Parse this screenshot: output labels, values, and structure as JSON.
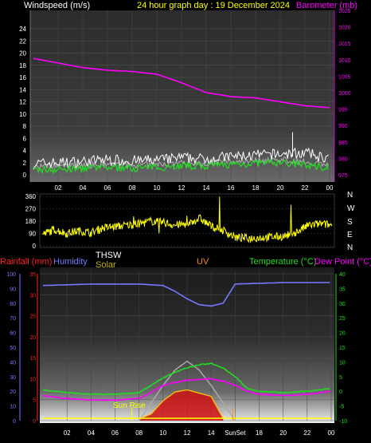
{
  "header": {
    "left_label": "Windspeed (m/s)",
    "title": "24 hour graph day : 19 December 2024",
    "right_label": "Barometer (mb)"
  },
  "colors": {
    "wind_gust": "#ffffff",
    "wind_avg": "#22dd22",
    "wind_white_avg": "#b0b0b0",
    "barometer": "#ff00ff",
    "direction": "#ffff00",
    "rain_axis": "#ff2222",
    "humidity": "#7777ff",
    "thsw": "#ffffff",
    "solar": "#c8b400",
    "uv": "#ff8800",
    "temperature": "#22dd22",
    "dew_point": "#ff00ff",
    "solar_fill": "#cc1111",
    "sun_curve": "#aaaaaa",
    "sun_rise_line": "#ffff00"
  },
  "x_ticks": [
    "02",
    "04",
    "06",
    "08",
    "10",
    "12",
    "14",
    "16",
    "18",
    "20",
    "22",
    "00"
  ],
  "x_ticks_bottom": [
    "02",
    "04",
    "06",
    "08",
    "10",
    "12",
    "14",
    "SunSet",
    "18",
    "20",
    "22",
    "00"
  ],
  "chart_data": [
    {
      "type": "line",
      "title": "24 hour graph day : 19 December 2024",
      "xlabel": "",
      "ylabel": "Windspeed (m/s)",
      "y2label": "Barometer (mb)",
      "x_hours": [
        0,
        2,
        4,
        6,
        8,
        10,
        12,
        14,
        16,
        18,
        20,
        22,
        24
      ],
      "ylim": [
        0,
        25
      ],
      "y_ticks": [
        0,
        2,
        4,
        6,
        8,
        10,
        12,
        14,
        16,
        18,
        20,
        22,
        24
      ],
      "y2lim": [
        972,
        1025
      ],
      "y2_ticks": [
        975,
        980,
        985,
        990,
        995,
        1000,
        1005,
        1010,
        1015,
        1020,
        1025
      ],
      "series": [
        {
          "name": "Barometer (mb)",
          "axis": "right",
          "values": [
            1010.4,
            1009.0,
            1007.6,
            1006.8,
            1006.4,
            1005.6,
            1003.0,
            1000.0,
            998.8,
            998.4,
            997.2,
            996.0,
            995.4
          ]
        },
        {
          "name": "gust",
          "axis": "left",
          "values": [
            1.8,
            2.0,
            2.2,
            2.5,
            2.3,
            2.4,
            2.8,
            2.6,
            3.0,
            3.2,
            3.4,
            3.6,
            2.6
          ]
        },
        {
          "name": "average",
          "axis": "left",
          "values": [
            0.8,
            0.9,
            1.0,
            1.2,
            1.1,
            1.2,
            1.5,
            1.4,
            1.7,
            1.9,
            2.0,
            1.6,
            1.2
          ]
        }
      ],
      "grid": true
    },
    {
      "type": "line",
      "xlabel": "",
      "ylabel": "",
      "ylim": [
        0,
        360
      ],
      "y_ticks": [
        0,
        90,
        180,
        270,
        360
      ],
      "right_labels": [
        "N",
        "W",
        "S",
        "E",
        "N"
      ],
      "series": [
        {
          "name": "direction",
          "x_hours": [
            0,
            1,
            2,
            3,
            4,
            5,
            6,
            7,
            8,
            9,
            10,
            11,
            12,
            13,
            14,
            15,
            16,
            17,
            18,
            19,
            20,
            21,
            22,
            23,
            24
          ],
          "values": [
            80,
            120,
            90,
            110,
            95,
            130,
            140,
            150,
            160,
            180,
            170,
            150,
            160,
            200,
            140,
            110,
            60,
            55,
            60,
            65,
            70,
            100,
            150,
            160,
            150
          ]
        }
      ],
      "grid": true
    },
    {
      "type": "line",
      "labels": [
        "Rainfall (mm)",
        "Humidity",
        "THSW",
        "Solar",
        "UV",
        "Temperature (°C)",
        "Dew Point (°C)"
      ],
      "annotations": [
        "Sun Rise",
        "SunSet"
      ],
      "left_axis": {
        "ticks": [
          0,
          5,
          10,
          15,
          20,
          25,
          30,
          35
        ]
      },
      "humidity_axis": {
        "ticks": [
          0,
          10,
          20,
          30,
          40,
          50,
          60,
          70,
          80,
          90,
          100
        ]
      },
      "right_axis": {
        "ticks": [
          -10,
          -5,
          0,
          5,
          10,
          15,
          20,
          25,
          30,
          35,
          40
        ]
      },
      "series": [
        {
          "name": "Humidity",
          "axis": "humidity",
          "x_hours": [
            0,
            4,
            8,
            10,
            11,
            12,
            13,
            14,
            15,
            16,
            20,
            24
          ],
          "values": [
            92,
            93,
            93,
            92,
            88,
            83,
            79,
            78,
            80,
            93,
            94,
            94
          ]
        },
        {
          "name": "Temperature (°C)",
          "axis": "right",
          "x_hours": [
            0,
            2,
            4,
            6,
            8,
            9,
            10,
            11,
            12,
            13,
            14,
            15,
            16,
            17,
            18,
            20,
            22,
            24
          ],
          "values": [
            0.5,
            -0.5,
            -1.0,
            -1.0,
            -0.5,
            2.0,
            4.5,
            6.5,
            8.0,
            9.0,
            9.5,
            8.0,
            5.0,
            1.0,
            0.0,
            -0.5,
            0.0,
            1.0
          ]
        },
        {
          "name": "Dew Point (°C)",
          "axis": "right",
          "x_hours": [
            0,
            2,
            4,
            6,
            8,
            9,
            10,
            11,
            12,
            13,
            14,
            15,
            16,
            17,
            18,
            20,
            22,
            24
          ],
          "values": [
            -1.5,
            -2.5,
            -3.0,
            -3.0,
            -2.5,
            -0.5,
            2.0,
            3.0,
            3.8,
            4.0,
            4.2,
            3.5,
            2.0,
            0.0,
            -1.0,
            -1.5,
            -1.0,
            0.0
          ]
        },
        {
          "name": "Solar",
          "axis": "solar",
          "x_hours": [
            8,
            9,
            10,
            11,
            12,
            13,
            14,
            14.5,
            15
          ],
          "values": [
            8,
            30,
            90,
            130,
            140,
            125,
            110,
            60,
            10
          ]
        },
        {
          "name": "Sun curve",
          "axis": "solar",
          "x_hours": [
            8,
            9,
            10,
            11,
            12,
            13,
            14,
            15,
            16
          ],
          "values": [
            0,
            80,
            160,
            230,
            270,
            230,
            160,
            80,
            0
          ]
        }
      ],
      "grid": true
    }
  ]
}
